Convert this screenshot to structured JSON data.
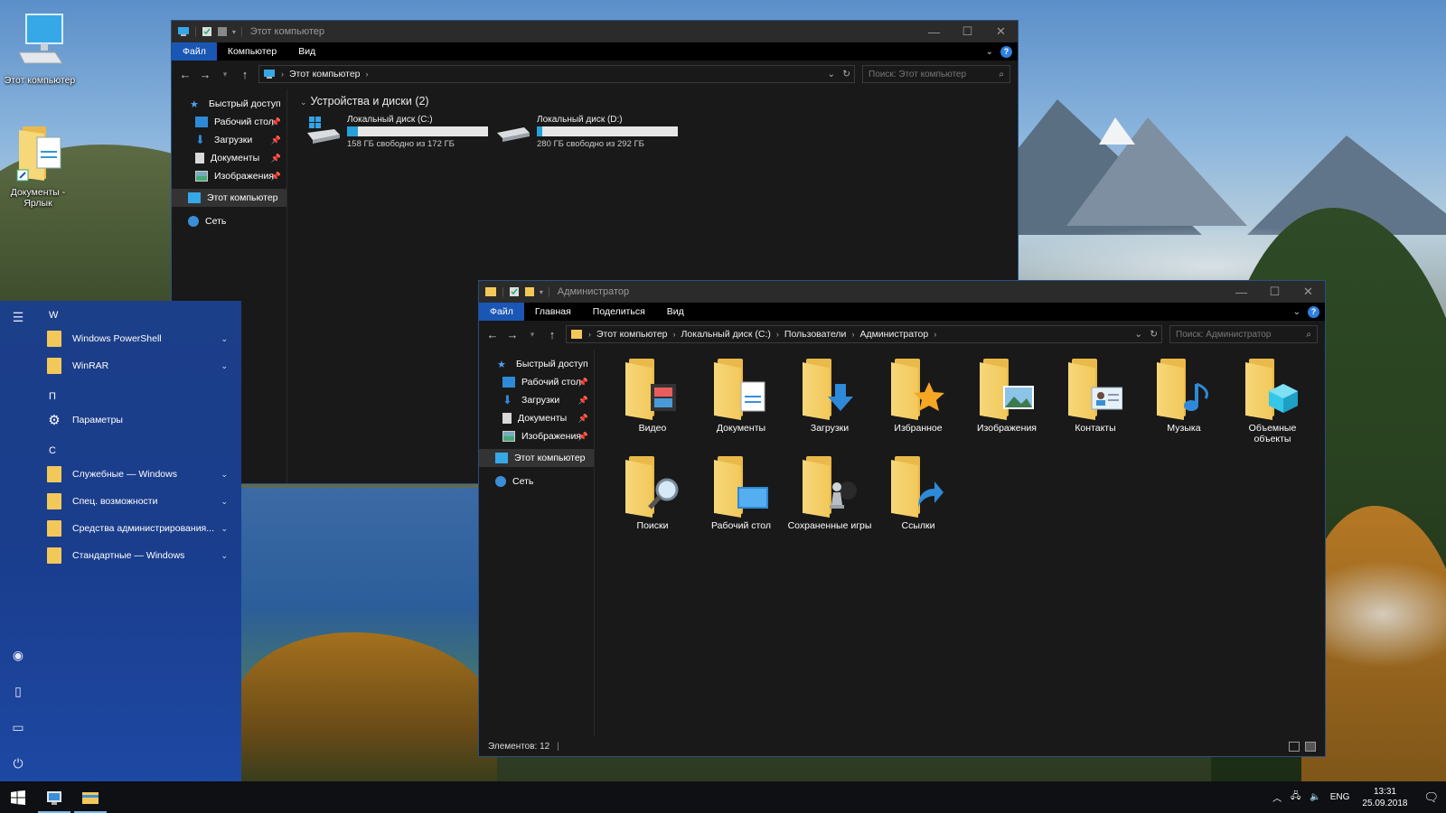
{
  "desktop": {
    "icons": [
      {
        "label": "Этот компьютер",
        "icon": "computer-icon"
      },
      {
        "label": "Документы - Ярлык",
        "icon": "documents-shortcut-icon"
      }
    ]
  },
  "win1": {
    "title": "Этот компьютер",
    "ribbon": {
      "file": "Файл",
      "tabs": [
        "Компьютер",
        "Вид"
      ]
    },
    "address": {
      "crumbs": [
        "Этот компьютер"
      ]
    },
    "search_placeholder": "Поиск: Этот компьютер",
    "nav": [
      {
        "label": "Быстрый доступ",
        "icon": "star-icon",
        "pinned": false
      },
      {
        "label": "Рабочий стол",
        "icon": "desktop-icon",
        "pinned": true
      },
      {
        "label": "Загрузки",
        "icon": "downloads-icon",
        "pinned": true
      },
      {
        "label": "Документы",
        "icon": "documents-icon",
        "pinned": true
      },
      {
        "label": "Изображения",
        "icon": "pictures-icon",
        "pinned": true
      },
      {
        "label": "Этот компьютер",
        "icon": "computer-icon",
        "pinned": false
      },
      {
        "label": "Сеть",
        "icon": "network-icon",
        "pinned": false
      }
    ],
    "group_header": "Устройства и диски (2)",
    "drives": [
      {
        "name": "Локальный диск (C:)",
        "free": "158 ГБ свободно из 172 ГБ",
        "used_fraction": 0.08
      },
      {
        "name": "Локальный диск (D:)",
        "free": "280 ГБ свободно из 292 ГБ",
        "used_fraction": 0.04
      }
    ]
  },
  "win2": {
    "title": "Администратор",
    "ribbon": {
      "file": "Файл",
      "tabs": [
        "Главная",
        "Поделиться",
        "Вид"
      ]
    },
    "address": {
      "crumbs": [
        "Этот компьютер",
        "Локальный диск (C:)",
        "Пользователи",
        "Администратор"
      ]
    },
    "search_placeholder": "Поиск: Администратор",
    "nav": [
      {
        "label": "Быстрый доступ",
        "icon": "star-icon",
        "pinned": false
      },
      {
        "label": "Рабочий стол",
        "icon": "desktop-icon",
        "pinned": true
      },
      {
        "label": "Загрузки",
        "icon": "downloads-icon",
        "pinned": true
      },
      {
        "label": "Документы",
        "icon": "documents-icon",
        "pinned": true
      },
      {
        "label": "Изображения",
        "icon": "pictures-icon",
        "pinned": true
      },
      {
        "label": "Этот компьютер",
        "icon": "computer-icon",
        "pinned": false
      },
      {
        "label": "Сеть",
        "icon": "network-icon",
        "pinned": false
      }
    ],
    "folders": [
      {
        "label": "Видео",
        "icon": "video-folder-icon"
      },
      {
        "label": "Документы",
        "icon": "documents-folder-icon"
      },
      {
        "label": "Загрузки",
        "icon": "downloads-folder-icon"
      },
      {
        "label": "Избранное",
        "icon": "favorites-folder-icon"
      },
      {
        "label": "Изображения",
        "icon": "pictures-folder-icon"
      },
      {
        "label": "Контакты",
        "icon": "contacts-folder-icon"
      },
      {
        "label": "Музыка",
        "icon": "music-folder-icon"
      },
      {
        "label": "Объемные объекты",
        "icon": "3d-objects-folder-icon"
      },
      {
        "label": "Поиски",
        "icon": "searches-folder-icon"
      },
      {
        "label": "Рабочий стол",
        "icon": "desktop-folder-icon"
      },
      {
        "label": "Сохраненные игры",
        "icon": "saved-games-folder-icon"
      },
      {
        "label": "Ссылки",
        "icon": "links-folder-icon"
      }
    ],
    "status": "Элементов: 12"
  },
  "start_menu": {
    "sections": [
      {
        "letter": "W",
        "items": [
          {
            "label": "Windows PowerShell",
            "expandable": true
          },
          {
            "label": "WinRAR",
            "expandable": true
          }
        ]
      },
      {
        "letter": "П",
        "items": [
          {
            "label": "Параметры",
            "expandable": false,
            "icon": "gear-icon"
          }
        ]
      },
      {
        "letter": "С",
        "items": [
          {
            "label": "Служебные — Windows",
            "expandable": true
          },
          {
            "label": "Спец. возможности",
            "expandable": true
          },
          {
            "label": "Средства администрирования...",
            "expandable": true
          },
          {
            "label": "Стандартные — Windows",
            "expandable": true
          }
        ]
      }
    ]
  },
  "taskbar": {
    "language": "ENG",
    "time": "13:31",
    "date": "25.09.2018"
  },
  "colors": {
    "accent": "#1a56b4",
    "window_bg": "#191919",
    "start_bg": "#1c3f8a",
    "folder": "#f2c85b"
  }
}
